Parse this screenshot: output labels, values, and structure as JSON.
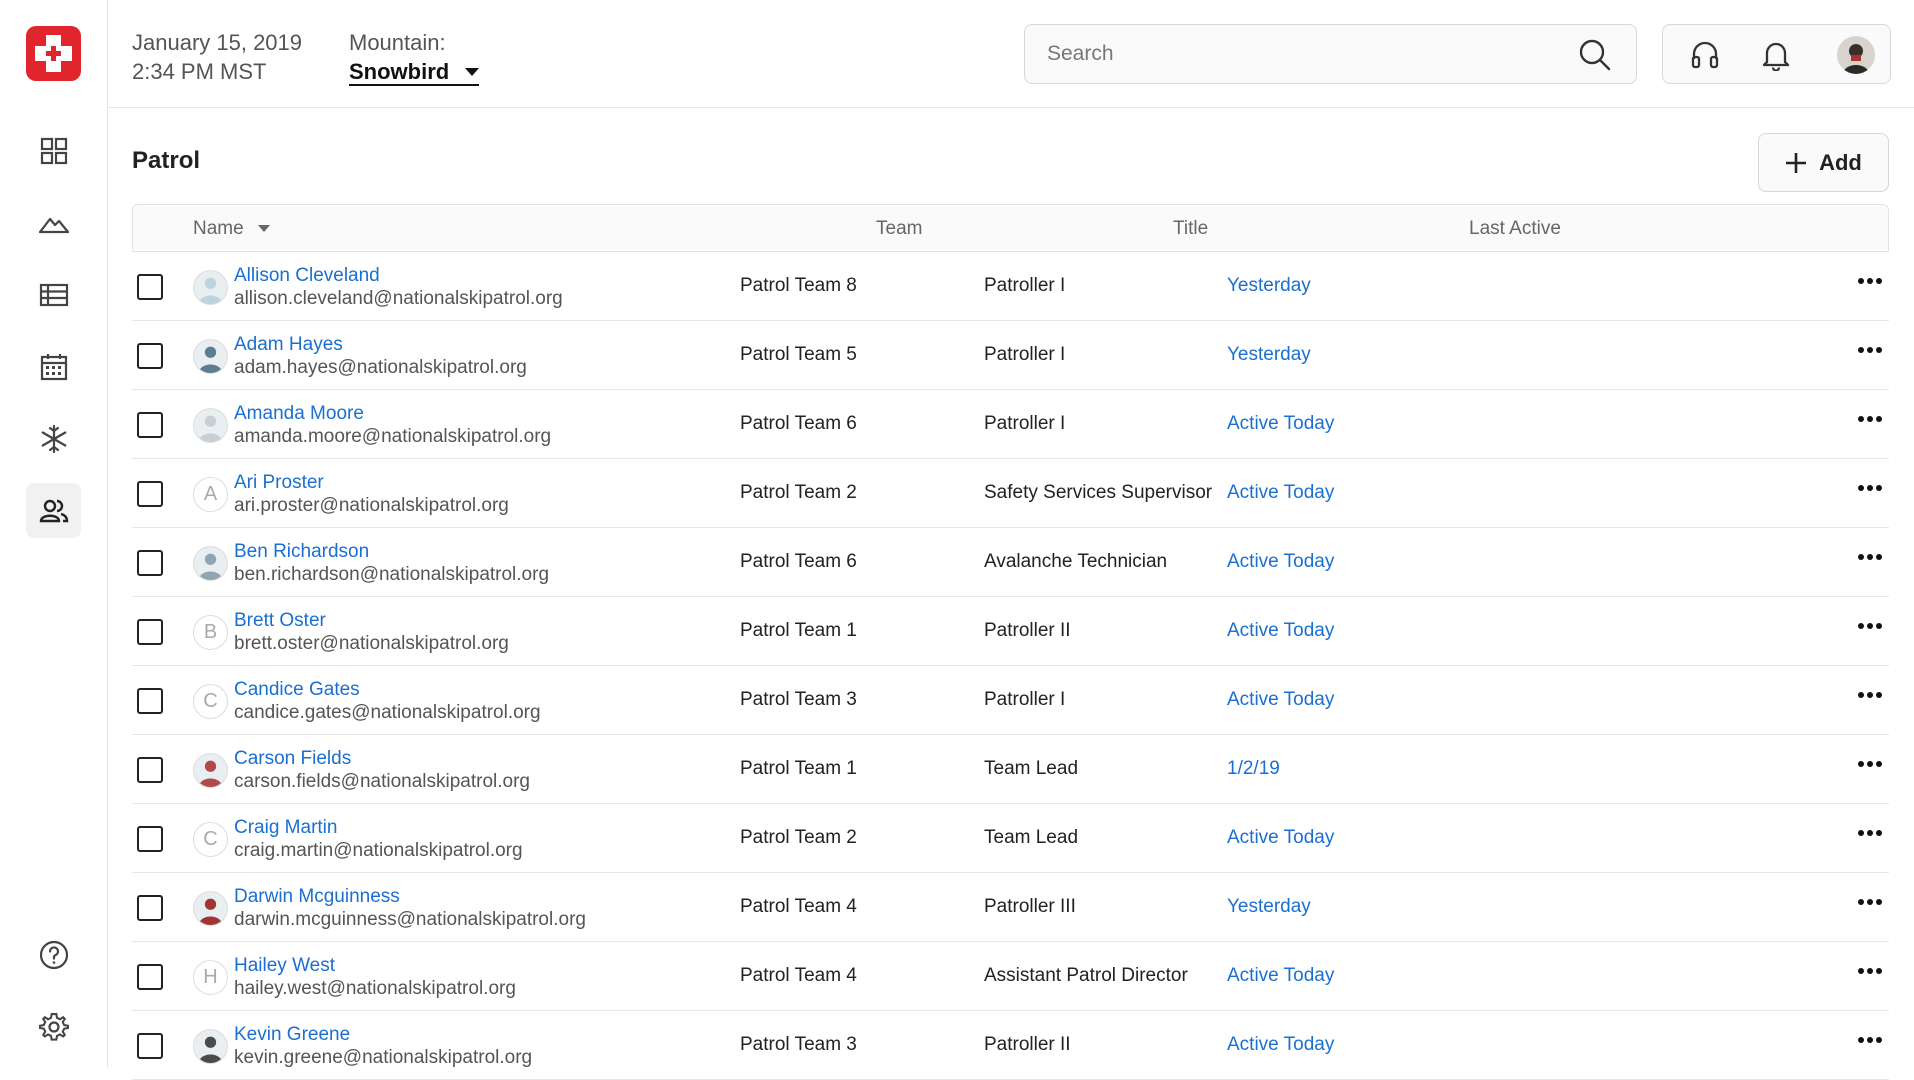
{
  "header": {
    "date": "January 15, 2019",
    "time": "2:34 PM MST",
    "mountain_label": "Mountain:",
    "mountain_value": "Snowbird",
    "search_placeholder": "Search"
  },
  "page": {
    "title": "Patrol",
    "add_label": "Add"
  },
  "table": {
    "columns": [
      "Name",
      "Team",
      "Title",
      "Last Active"
    ],
    "rows": [
      {
        "name": "Allison Cleveland",
        "email": "allison.cleveland@nationalskipatrol.org",
        "team": "Patrol Team 8",
        "title": "Patroller I",
        "last_active": "Yesterday",
        "avatar": "photo",
        "avatar_color": "#bcd3e0"
      },
      {
        "name": "Adam Hayes",
        "email": "adam.hayes@nationalskipatrol.org",
        "team": "Patrol Team 5",
        "title": "Patroller I",
        "last_active": "Yesterday",
        "avatar": "photo",
        "avatar_color": "#5b7f92"
      },
      {
        "name": "Amanda Moore",
        "email": "amanda.moore@nationalskipatrol.org",
        "team": "Patrol Team 6",
        "title": "Patroller I",
        "last_active": "Active Today",
        "avatar": "photo",
        "avatar_color": "#c9cfd4"
      },
      {
        "name": "Ari Proster",
        "email": "ari.proster@nationalskipatrol.org",
        "team": "Patrol Team 2",
        "title": "Safety Services Supervisor",
        "last_active": "Active Today",
        "avatar": "A",
        "avatar_color": ""
      },
      {
        "name": "Ben Richardson",
        "email": "ben.richardson@nationalskipatrol.org",
        "team": "Patrol Team 6",
        "title": "Avalanche Technician",
        "last_active": "Active Today",
        "avatar": "photo",
        "avatar_color": "#8fa6b2"
      },
      {
        "name": "Brett Oster",
        "email": "brett.oster@nationalskipatrol.org",
        "team": "Patrol Team 1",
        "title": "Patroller II",
        "last_active": "Active Today",
        "avatar": "B",
        "avatar_color": ""
      },
      {
        "name": "Candice Gates",
        "email": "candice.gates@nationalskipatrol.org",
        "team": "Patrol Team 3",
        "title": "Patroller I",
        "last_active": "Active Today",
        "avatar": "C",
        "avatar_color": ""
      },
      {
        "name": "Carson Fields",
        "email": "carson.fields@nationalskipatrol.org",
        "team": "Patrol Team 1",
        "title": "Team Lead",
        "last_active": "1/2/19",
        "avatar": "photo",
        "avatar_color": "#b24a4a"
      },
      {
        "name": "Craig Martin",
        "email": "craig.martin@nationalskipatrol.org",
        "team": "Patrol Team 2",
        "title": "Team Lead",
        "last_active": "Active Today",
        "avatar": "C",
        "avatar_color": ""
      },
      {
        "name": "Darwin Mcguinness",
        "email": "darwin.mcguinness@nationalskipatrol.org",
        "team": "Patrol Team 4",
        "title": "Patroller III",
        "last_active": "Yesterday",
        "avatar": "photo",
        "avatar_color": "#a33434"
      },
      {
        "name": "Hailey West",
        "email": "hailey.west@nationalskipatrol.org",
        "team": "Patrol Team 4",
        "title": "Assistant Patrol Director",
        "last_active": "Active Today",
        "avatar": "H",
        "avatar_color": ""
      },
      {
        "name": "Kevin Greene",
        "email": "kevin.greene@nationalskipatrol.org",
        "team": "Patrol Team 3",
        "title": "Patroller II",
        "last_active": "Active Today",
        "avatar": "photo",
        "avatar_color": "#4b4b4b"
      }
    ]
  },
  "icons": {
    "logo": "ski-patrol-cross-logo",
    "nav": [
      "dashboard-icon",
      "mountain-icon",
      "list-icon",
      "calendar-icon",
      "snowflake-icon",
      "users-icon",
      "help-icon",
      "gear-icon"
    ],
    "top": [
      "search-icon",
      "headset-icon",
      "bell-icon"
    ]
  },
  "colors": {
    "brand": "#e0262c",
    "link": "#1a6fd1"
  }
}
